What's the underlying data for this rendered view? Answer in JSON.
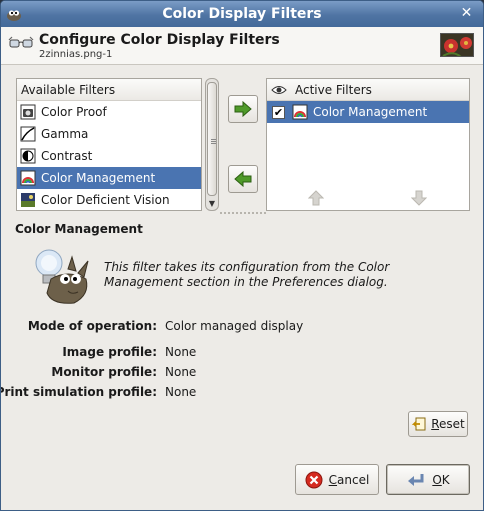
{
  "window": {
    "title": "Color Display Filters"
  },
  "header": {
    "title": "Configure Color Display Filters",
    "subtitle": "2zinnias.png-1"
  },
  "available": {
    "heading": "Available Filters",
    "items": [
      {
        "label": "Color Proof",
        "icon": "color-proof-icon"
      },
      {
        "label": "Gamma",
        "icon": "gamma-icon"
      },
      {
        "label": "Contrast",
        "icon": "contrast-icon"
      },
      {
        "label": "Color Management",
        "icon": "color-management-icon",
        "selected": true
      },
      {
        "label": "Color Deficient Vision",
        "icon": "color-deficient-vision-icon"
      }
    ]
  },
  "active": {
    "heading": "Active Filters",
    "items": [
      {
        "label": "Color Management",
        "checked": true,
        "selected": true
      }
    ]
  },
  "config": {
    "title": "Color Management",
    "description": "This filter takes its configuration from the Color Management section in the Preferences dialog.",
    "fields": [
      {
        "label": "Mode of operation:",
        "value": "Color managed display"
      },
      {
        "label": "Image profile:",
        "value": "None"
      },
      {
        "label": "Monitor profile:",
        "value": "None"
      },
      {
        "label": "Print simulation profile:",
        "value": "None"
      }
    ]
  },
  "buttons": {
    "reset": "Reset",
    "cancel": "Cancel",
    "ok": "OK"
  },
  "colors": {
    "titlebar": "#4f74a3",
    "selection": "#4a74b1",
    "arrow_green": "#3e8a1e"
  }
}
